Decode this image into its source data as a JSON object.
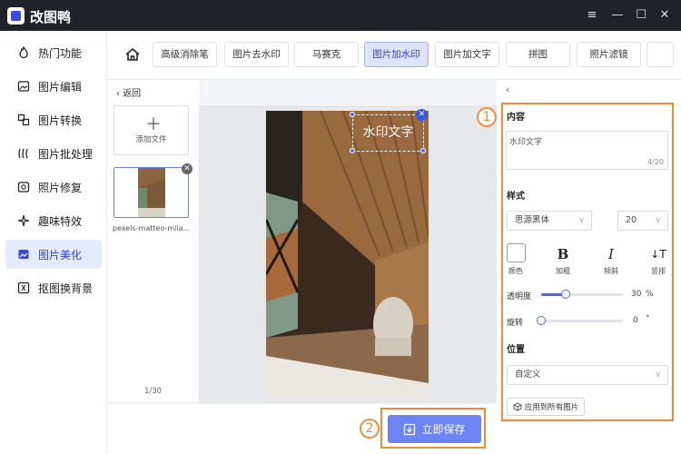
{
  "app": {
    "title": "改图鸭",
    "brand_color": "#3a49e0"
  },
  "window_controls": {
    "menu": "≡",
    "minimize": "—",
    "maximize": "☐",
    "close": "✕"
  },
  "sidebar": {
    "items": [
      {
        "label": "热门功能",
        "icon": "fire-icon"
      },
      {
        "label": "图片编辑",
        "icon": "image-edit-icon"
      },
      {
        "label": "图片转换",
        "icon": "convert-icon"
      },
      {
        "label": "图片批处理",
        "icon": "batch-icon"
      },
      {
        "label": "照片修复",
        "icon": "photo-repair-icon"
      },
      {
        "label": "趣味特效",
        "icon": "effects-icon"
      },
      {
        "label": "图片美化",
        "icon": "beautify-icon",
        "active": true
      },
      {
        "label": "抠图换背景",
        "icon": "cutout-icon"
      }
    ]
  },
  "toolbar": {
    "tabs": [
      {
        "label": "高级消除笔"
      },
      {
        "label": "图片去水印"
      },
      {
        "label": "马赛克"
      },
      {
        "label": "图片加水印",
        "active": true
      },
      {
        "label": "图片加文字"
      },
      {
        "label": "拼图"
      },
      {
        "label": "照片滤镜"
      }
    ]
  },
  "filelist": {
    "back_label": "返回",
    "add_file_label": "添加文件",
    "files": [
      {
        "name": "pexels-matteo-mila..."
      }
    ],
    "page_count": "1/30"
  },
  "canvas": {
    "watermark_text": "水印文字"
  },
  "panel": {
    "content_title": "内容",
    "content_value": "水印文字",
    "char_count": "4/20",
    "style_title": "样式",
    "font": "思源黑体",
    "font_size": "20",
    "style_buttons": [
      {
        "glyph": "",
        "label": "颜色"
      },
      {
        "glyph": "B",
        "label": "加粗"
      },
      {
        "glyph": "I",
        "label": "倾斜"
      },
      {
        "glyph": "↓T",
        "label": "竖排"
      }
    ],
    "opacity_label": "透明度",
    "opacity_value": "30",
    "opacity_unit": "%",
    "opacity_fraction": 0.3,
    "rotate_label": "旋转",
    "rotate_value": "0",
    "rotate_unit": "°",
    "rotate_fraction": 0,
    "position_title": "位置",
    "position_value": "自定义",
    "apply_all_label": "应用到所有图片"
  },
  "annotations": {
    "num1": "1",
    "num2": "2",
    "highlight_color": "#ef8b3c"
  },
  "save_button": {
    "label": "立即保存"
  }
}
